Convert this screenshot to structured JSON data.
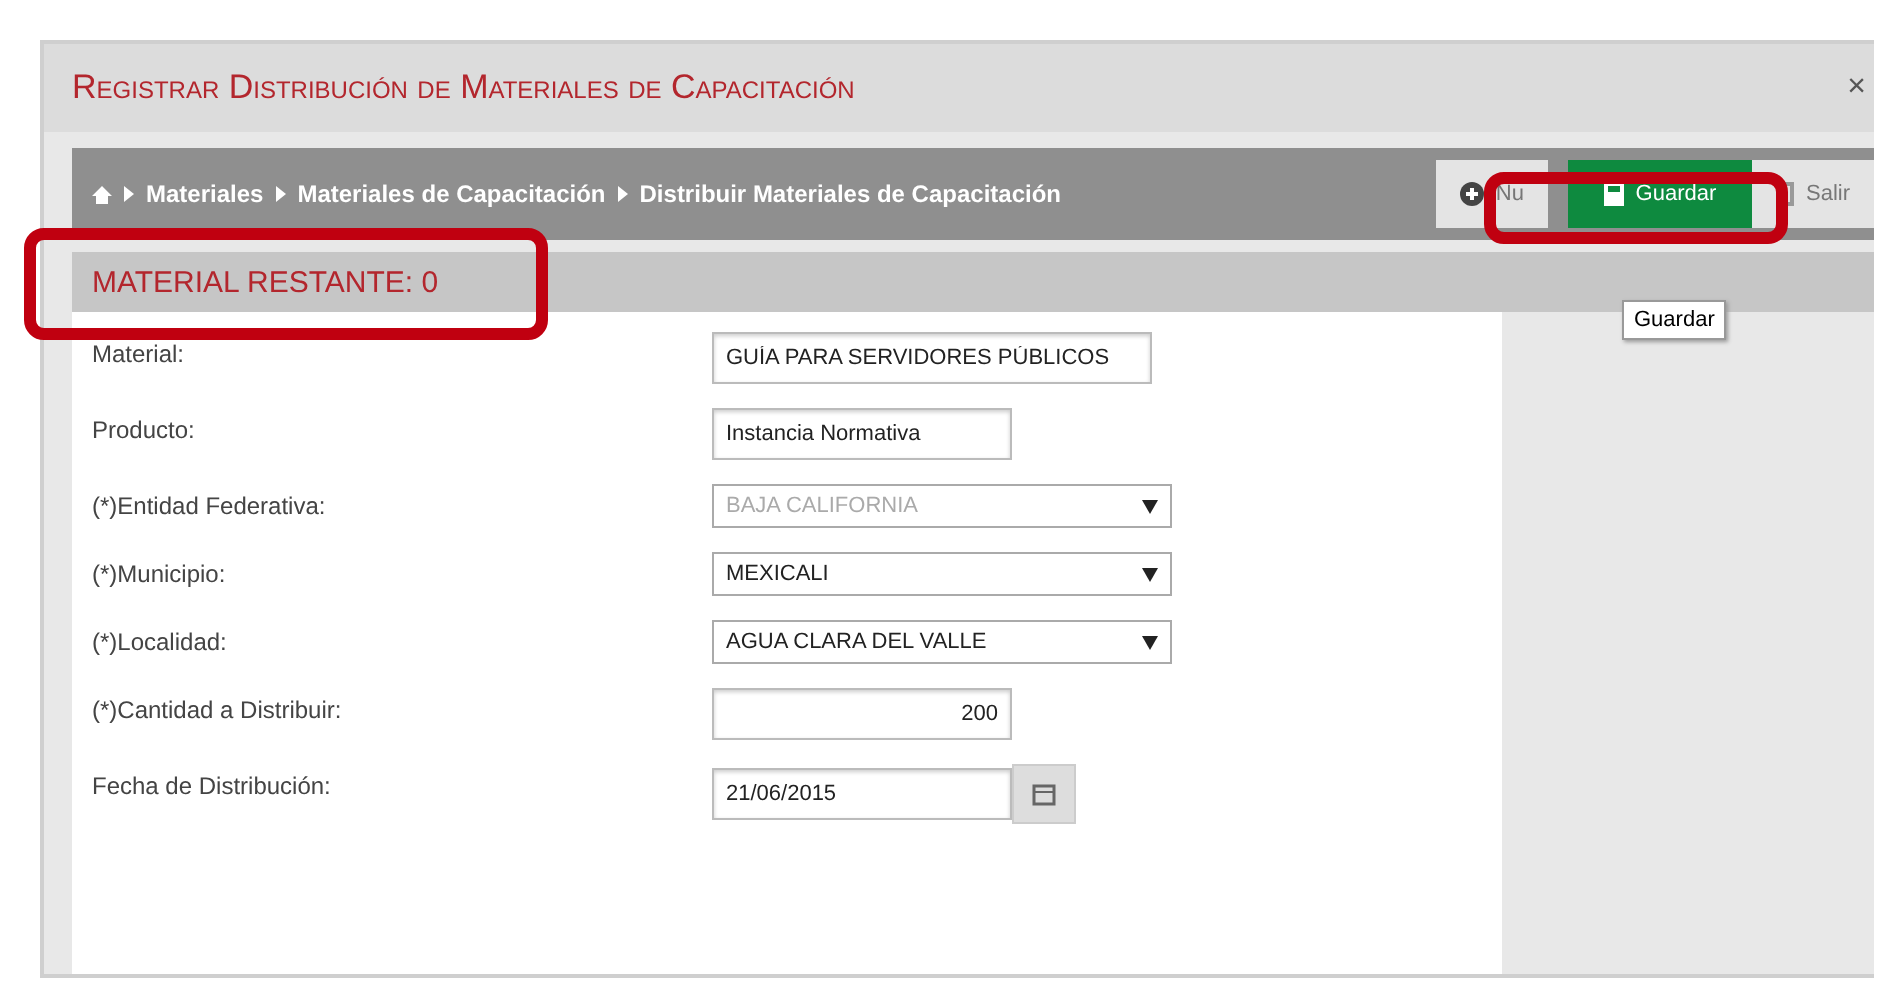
{
  "window": {
    "title": "Registrar Distribución de Materiales de Capacitación",
    "close": "×"
  },
  "breadcrumb": [
    "Materiales",
    "Materiales de Capacitación",
    "Distribuir Materiales de Capacitación"
  ],
  "toolbar_buttons": [
    {
      "label": "Nu",
      "kind": "new",
      "selected": false
    },
    {
      "label": "Guardar",
      "kind": "save",
      "selected": true
    },
    {
      "label": "Salir",
      "kind": "exit",
      "selected": false
    }
  ],
  "tooltip": "Guardar",
  "remaining": "MATERIAL RESTANTE: 0",
  "form": [
    {
      "label": "Material:",
      "kind": "text",
      "value": "GUÍA PARA SERVIDORES PÚBLICOS",
      "disabled": false
    },
    {
      "label": "Producto:",
      "kind": "text",
      "value": "Instancia Normativa",
      "disabled": false
    },
    {
      "label": "(*)Entidad Federativa:",
      "kind": "select",
      "value": "BAJA CALIFORNIA",
      "disabled": true
    },
    {
      "label": "(*)Municipio:",
      "kind": "select",
      "value": "MEXICALI",
      "disabled": false
    },
    {
      "label": "(*)Localidad:",
      "kind": "select",
      "value": "AGUA CLARA DEL VALLE",
      "disabled": false
    },
    {
      "label": "(*)Cantidad a Distribuir:",
      "kind": "number",
      "value": "200",
      "disabled": false
    },
    {
      "label": "Fecha de Distribución:",
      "kind": "date",
      "value": "21/06/2015",
      "disabled": false
    }
  ]
}
